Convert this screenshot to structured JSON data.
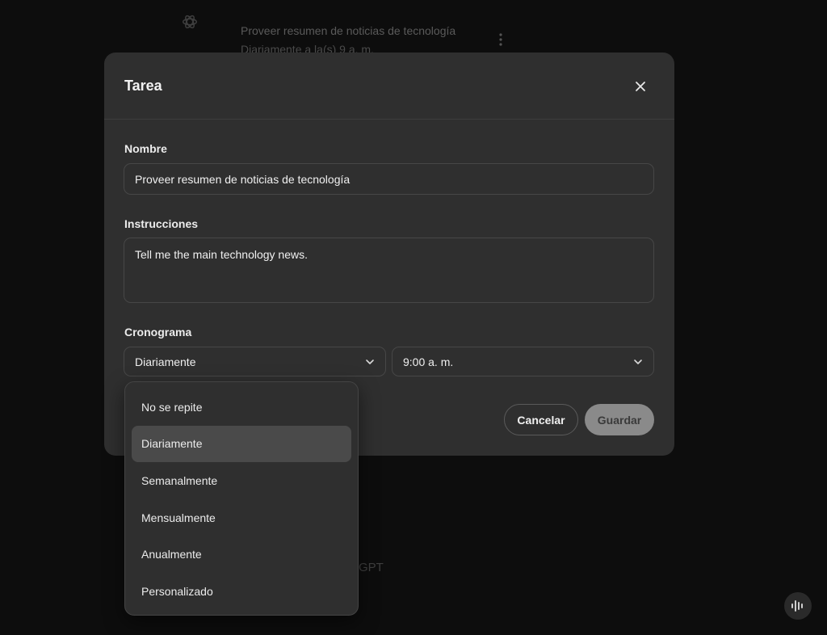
{
  "background": {
    "task_title": "Proveer resumen de noticias de tecnología",
    "task_subtitle": "Diariamente a la(s) 9 a. m.",
    "footer_text": "GPT"
  },
  "modal": {
    "title": "Tarea",
    "name_label": "Nombre",
    "name_value": "Proveer resumen de noticias de tecnología",
    "instructions_label": "Instrucciones",
    "instructions_value": "Tell me the main technology news.",
    "schedule_label": "Cronograma",
    "frequency_value": "Diariamente",
    "time_value": "9:00 a. m.",
    "cancel_label": "Cancelar",
    "save_label": "Guardar"
  },
  "dropdown": {
    "items": [
      {
        "label": "No se repite"
      },
      {
        "label": "Diariamente"
      },
      {
        "label": "Semanalmente"
      },
      {
        "label": "Mensualmente"
      },
      {
        "label": "Anualmente"
      },
      {
        "label": "Personalizado"
      }
    ],
    "selected": "Diariamente"
  },
  "icons": {
    "logo": "openai-logo-icon",
    "kebab": "kebab-menu-icon",
    "close": "close-icon",
    "chevron": "chevron-down-icon",
    "voice": "voice-waveform-icon"
  }
}
